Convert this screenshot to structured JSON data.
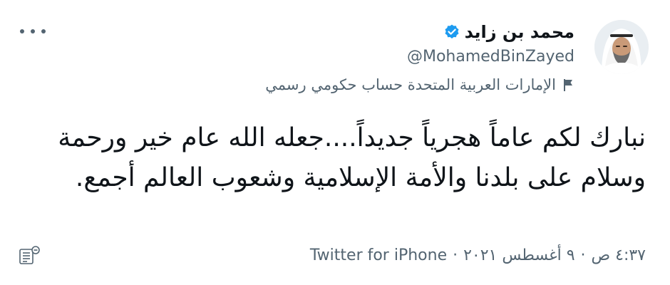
{
  "tweet": {
    "author": {
      "name": "محمد بن زايد",
      "handle": "@MohamedBinZayed",
      "verified": true,
      "label": "الإمارات العربية المتحدة حساب حكومي رسمي",
      "label_icon": "flag-icon",
      "avatar_icon": "avatar"
    },
    "text": "نبارك لكم عاماً هجرياً جديداً....جعله الله عام خير ورحمة وسلام على بلدنا والأمة الإسلامية وشعوب العالم أجمع.",
    "timestamp": {
      "time": "٤:٣٧ ص",
      "date": "٩ أغسطس ٢٠٢١",
      "separator": "·",
      "source": "Twitter for iPhone"
    },
    "more_icon": "more-horizontal-icon",
    "lists_icon": "lists-icon"
  },
  "colors": {
    "text_primary": "#0f1419",
    "text_secondary": "#536471",
    "verified_blue": "#1d9bf0"
  }
}
